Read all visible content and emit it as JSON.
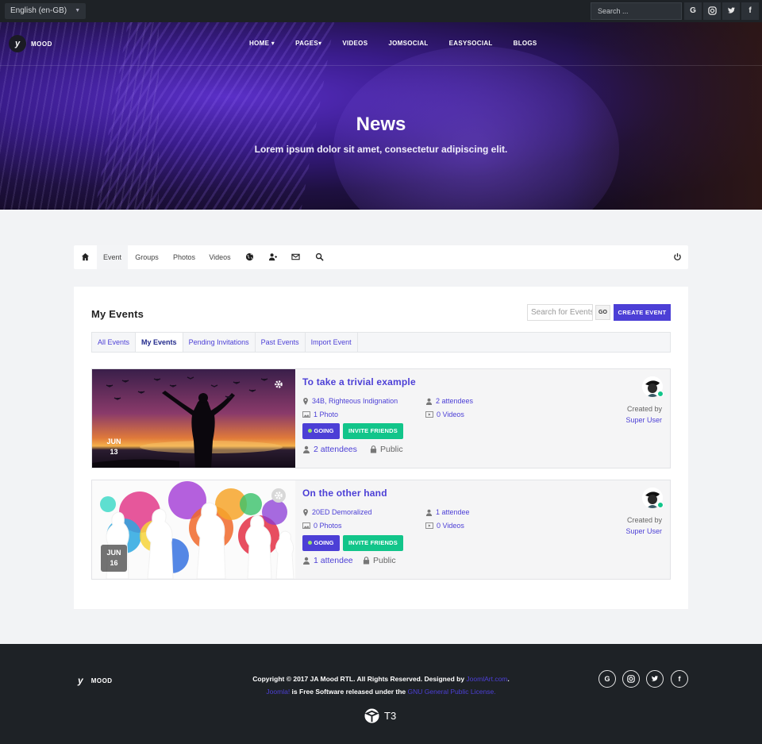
{
  "topbar": {
    "language": "English (en-GB)",
    "search_placeholder": "Search ...",
    "social": [
      "G",
      "instagram-icon",
      "twitter-icon",
      "f"
    ]
  },
  "header": {
    "logo_mark": "y",
    "logo_text": "MOOD",
    "nav": [
      {
        "label": "HOME",
        "dropdown": true
      },
      {
        "label": "PAGES",
        "dropdown": true
      },
      {
        "label": "VIDEOS"
      },
      {
        "label": "JOMSOCIAL"
      },
      {
        "label": "EASYSOCIAL"
      },
      {
        "label": "BLOGS"
      }
    ],
    "title": "News",
    "subtitle": "Lorem ipsum dolor sit amet, consectetur adipiscing elit."
  },
  "toolbar": {
    "items": [
      "Event",
      "Groups",
      "Photos",
      "Videos"
    ],
    "active": "Event"
  },
  "events": {
    "title": "My Events",
    "search_placeholder": "Search for Events",
    "go_label": "GO",
    "create_label": "CREATE EVENT",
    "filters": [
      "All Events",
      "My Events",
      "Pending Invitations",
      "Past Events",
      "Import Event"
    ],
    "active_filter": "My Events",
    "list": [
      {
        "title": "To take a trivial example",
        "month": "JUN",
        "day": "13",
        "location": "34B, Righteous Indignation",
        "attendees_short": "2 attendees",
        "photos": "1 Photo",
        "videos": "0 Videos",
        "going_label": "GOING",
        "invite_label": "INVITE FRIENDS",
        "attendees": "2 attendees",
        "privacy": "Public",
        "created_by_label": "Created by",
        "creator": "Super User"
      },
      {
        "title": "On the other hand",
        "month": "JUN",
        "day": "16",
        "location": "20ED Demoralized",
        "attendees_short": "1 attendee",
        "photos": "0 Photos",
        "videos": "0 Videos",
        "going_label": "GOING",
        "invite_label": "INVITE FRIENDS",
        "attendees": "1 attendee",
        "privacy": "Public",
        "created_by_label": "Created by",
        "creator": "Super User"
      }
    ]
  },
  "footer": {
    "logo_mark": "y",
    "logo_text": "MOOD",
    "copyright_prefix": "Copyright © 2017 JA Mood RTL. All Rights Reserved. Designed by ",
    "designer": "JoomlArt.com",
    "copyright_suffix": ".",
    "joomla": "Joomla!",
    "license_prefix": " is Free Software released under the ",
    "license": "GNU General Public License.",
    "social": [
      "G",
      "instagram-icon",
      "twitter-icon",
      "f"
    ],
    "t3_label": "T3"
  },
  "colors": {
    "accent": "#4c3fd6",
    "success": "#12c58a",
    "dark": "#1e2226"
  }
}
